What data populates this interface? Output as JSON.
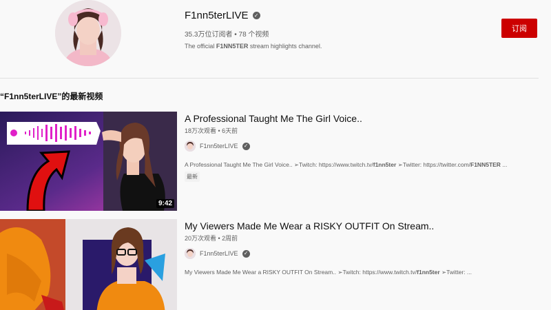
{
  "channel": {
    "name": "F1nn5terLIVE",
    "meta": "35.3万位订阅者 • 78 个视频",
    "desc_prefix": "The official ",
    "desc_bold": "F1NN5TER",
    "desc_suffix": " stream highlights channel.",
    "subscribe_label": "订阅",
    "subscribe_color": "#cc0000"
  },
  "section": {
    "title": "“F1nn5terLIVE”的最新视频"
  },
  "videos": [
    {
      "title": "A Professional Taught Me The Girl Voice..",
      "meta": "18万次观看 • 6天前",
      "author": "F1nn5terLIVE",
      "desc_1": "A Professional Taught Me The Girl Voice.. ➢Twitch: https://www.twitch.tv/",
      "desc_b1": "f1nn5ter",
      "desc_2": " ➢Twitter: https://twitter.com/",
      "desc_b2": "F1NN5TER",
      "desc_3": " ...",
      "badge": "最新",
      "duration": "9:42"
    },
    {
      "title": "My Viewers Made Me Wear a RISKY OUTFIT On Stream..",
      "meta": "20万次观看 • 2周前",
      "author": "F1nn5terLIVE",
      "desc_1": "My Viewers Made Me Wear a RISKY OUTFIT On Stream.. ➢Twitch: https://www.twitch.tv/",
      "desc_b1": "f1nn5ter",
      "desc_2": " ➢Twitter: ...",
      "desc_b2": "",
      "desc_3": "",
      "badge": "",
      "duration": ""
    }
  ]
}
